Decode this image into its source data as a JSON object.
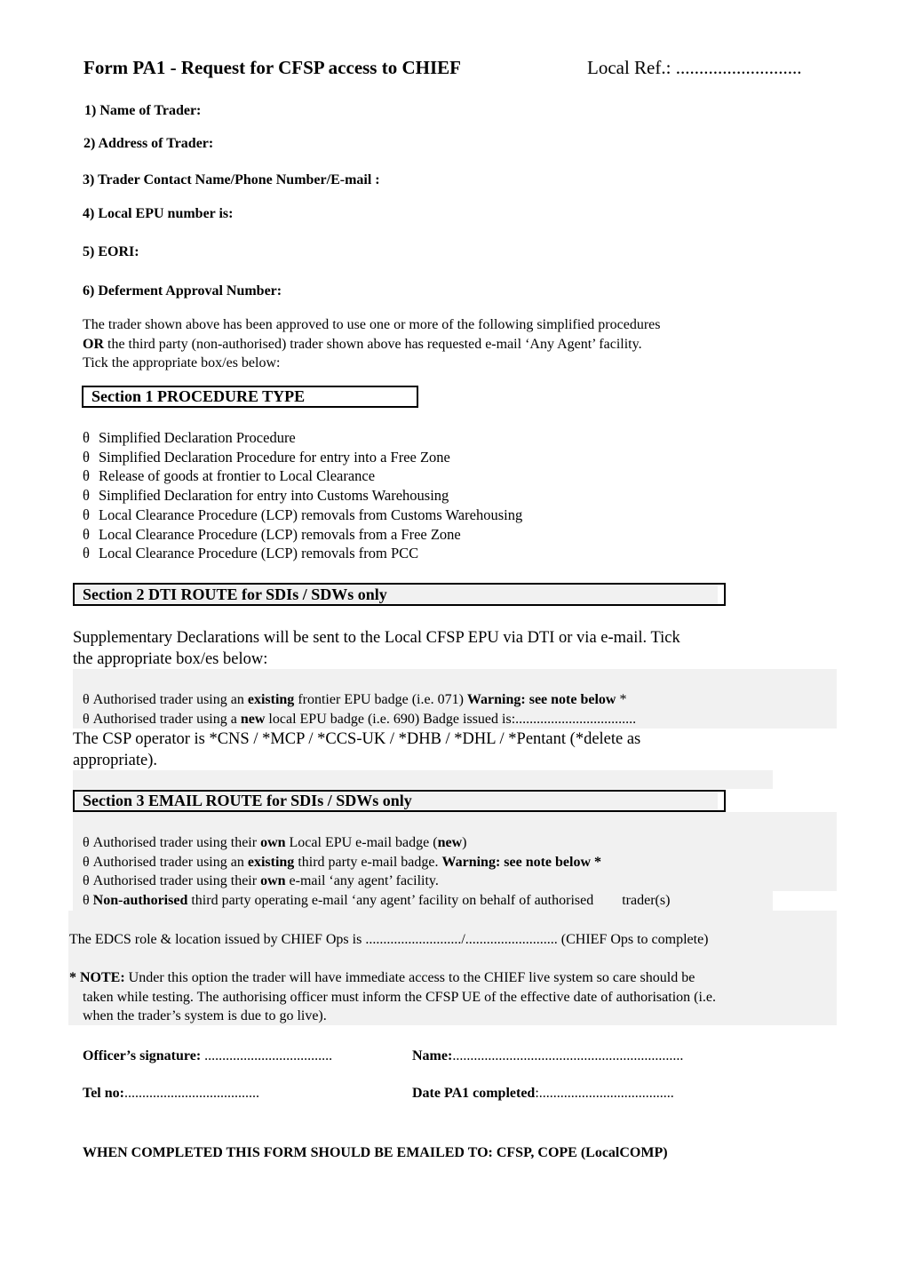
{
  "header": {
    "title": "Form PA1 - Request for CFSP access to CHIEF",
    "local_ref": "Local Ref.: ..........................."
  },
  "fields": [
    "1) Name of Trader:",
    "2) Address of Trader:",
    "3) Trader Contact Name/Phone Number/E-mail :",
    "4) Local EPU number is:",
    "5) EORI:",
    "6) Deferment Approval Number:"
  ],
  "intro": {
    "line1": "The trader shown above has been approved to use one or more of the following simplified procedures",
    "line2_bold": "OR",
    "line2_rest": " the third party (non-authorised) trader shown above has requested e-mail ‘Any Agent’ facility.",
    "line3": "Tick the appropriate box/es below:"
  },
  "tick_glyph": "θ",
  "section1": {
    "title": "Section 1  PROCEDURE TYPE",
    "items": [
      "Simplified Declaration Procedure",
      "Simplified Declaration Procedure for entry into a Free Zone",
      "Release of goods at frontier to Local Clearance",
      "Simplified Declaration for entry into Customs Warehousing",
      "Local Clearance Procedure (LCP) removals from Customs Warehousing",
      "Local Clearance Procedure (LCP) removals from a Free Zone",
      "Local Clearance Procedure (LCP) removals from PCC"
    ]
  },
  "section2": {
    "title": "Section 2 DTI ROUTE for SDIs / SDWs only",
    "intro_line1": "Supplementary Declarations will be sent to the Local CFSP EPU via DTI or via e-mail.  Tick",
    "intro_line2": "the appropriate box/es below:",
    "items": [
      {
        "a": " Authorised trader using an ",
        "b": "existing",
        "c": " frontier EPU badge (i.e. 071) ",
        "d": "Warning: see note below",
        "e": " *"
      },
      {
        "a": " Authorised trader using a ",
        "b": "new",
        "c": " local EPU badge (i.e. 690) Badge issued is:..................................",
        "d": "",
        "e": ""
      }
    ],
    "csp_line1": " The CSP operator is *CNS / *MCP / *CCS-UK / *DHB / *DHL / *Pentant (*delete as",
    "csp_line2": "appropriate)."
  },
  "section3": {
    "title": "Section 3 EMAIL ROUTE for SDIs / SDWs only",
    "items": [
      {
        "a": " Authorised trader using their ",
        "b": "own",
        "c": " Local EPU e-mail badge (",
        "d": "new",
        "e": ")"
      },
      {
        "a": " Authorised trader using an ",
        "b": "existing",
        "c": " third party e-mail badge. ",
        "d": "Warning: see note below *",
        "e": ""
      },
      {
        "a": " Authorised trader using their ",
        "b": "own",
        "c": " e-mail ‘any agent’ facility.",
        "d": "",
        "e": ""
      },
      {
        "a": " ",
        "b": "Non-authorised",
        "c": " third party operating e-mail ‘any agent’ facility on behalf of authorised",
        "d": "",
        "e": "trader(s)"
      }
    ]
  },
  "edcs_line": "The EDCS role & location issued by CHIEF Ops is .........................../.......................... (CHIEF Ops to complete)",
  "note": {
    "star": "* ",
    "label": "NOTE:",
    "line1": " Under this option the trader will have immediate access to the CHIEF live system so care should be",
    "line2": "taken while testing. The authorising officer must inform the CFSP UE of the effective date of authorisation (i.e.",
    "line3": "when the trader’s system is due to go live)."
  },
  "signatures": {
    "officer_label": "Officer’s signature:",
    "officer_dots": " ....................................",
    "name_label": "Name:",
    "name_dots": ".................................................................",
    "tel_label": "Tel no:",
    "tel_dots": "......................................",
    "date_label": "Date PA1 completed",
    "date_dots": ":......................................"
  },
  "footer": "WHEN COMPLETED THIS FORM SHOULD BE EMAILED TO: CFSP, COPE (LocalCOMP)"
}
